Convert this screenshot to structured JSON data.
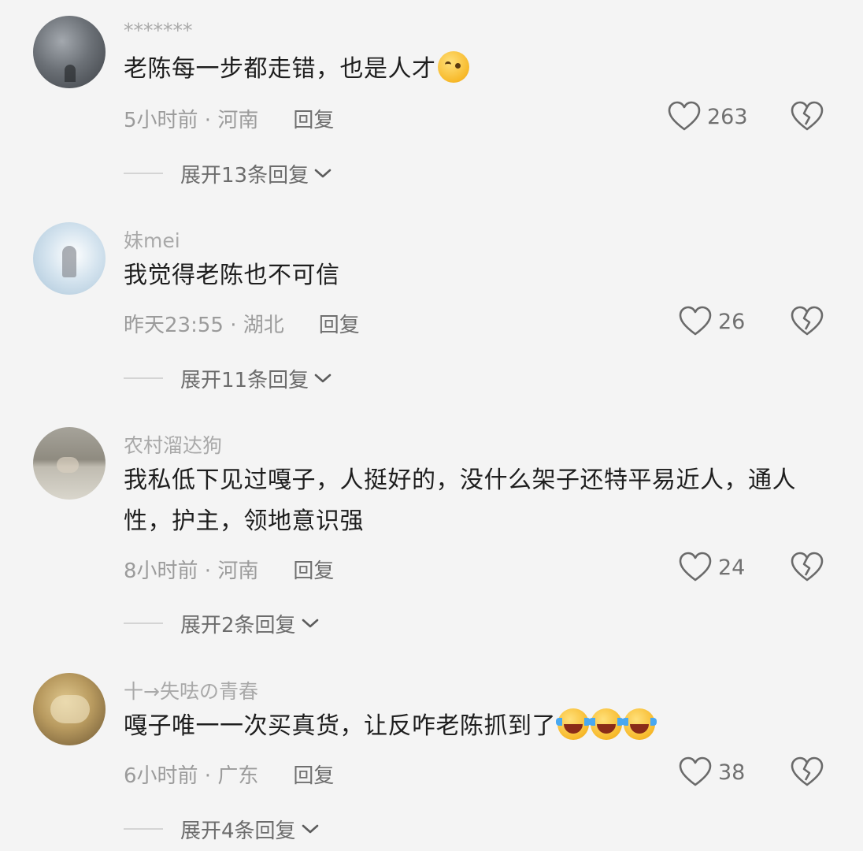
{
  "comments": [
    {
      "username": "*******",
      "content": "老陈每一步都走错，也是人才",
      "emoji": "thinking-face",
      "time": "5小时前",
      "location": "河南",
      "reply_label": "回复",
      "likes": "263",
      "expand_label": "展开13条回复"
    },
    {
      "username": "妹mei",
      "content": "我觉得老陈也不可信",
      "emoji": "",
      "time": "昨天23:55",
      "location": "湖北",
      "reply_label": "回复",
      "likes": "26",
      "expand_label": "展开11条回复"
    },
    {
      "username": "农村溜达狗",
      "content": "我私低下见过嘎子，人挺好的，没什么架子还特平易近人，通人性，护主，领地意识强",
      "emoji": "",
      "time": "8小时前",
      "location": "河南",
      "reply_label": "回复",
      "likes": "24",
      "expand_label": "展开2条回复"
    },
    {
      "username": "十→失呿の青春",
      "content": "嘎子唯一一次买真货，让反咋老陈抓到了",
      "emoji": "laughing-crying-face x3",
      "time": "6小时前",
      "location": "广东",
      "reply_label": "回复",
      "likes": "38",
      "expand_label": "展开4条回复"
    }
  ],
  "separator": " · ",
  "icons": {
    "like": "heart-outline-icon",
    "dislike": "broken-heart-icon",
    "expand": "chevron-down-icon"
  },
  "colors": {
    "background": "#f4f4f4",
    "meta_text": "#9b9b9b",
    "icon": "#6a6a6a"
  }
}
